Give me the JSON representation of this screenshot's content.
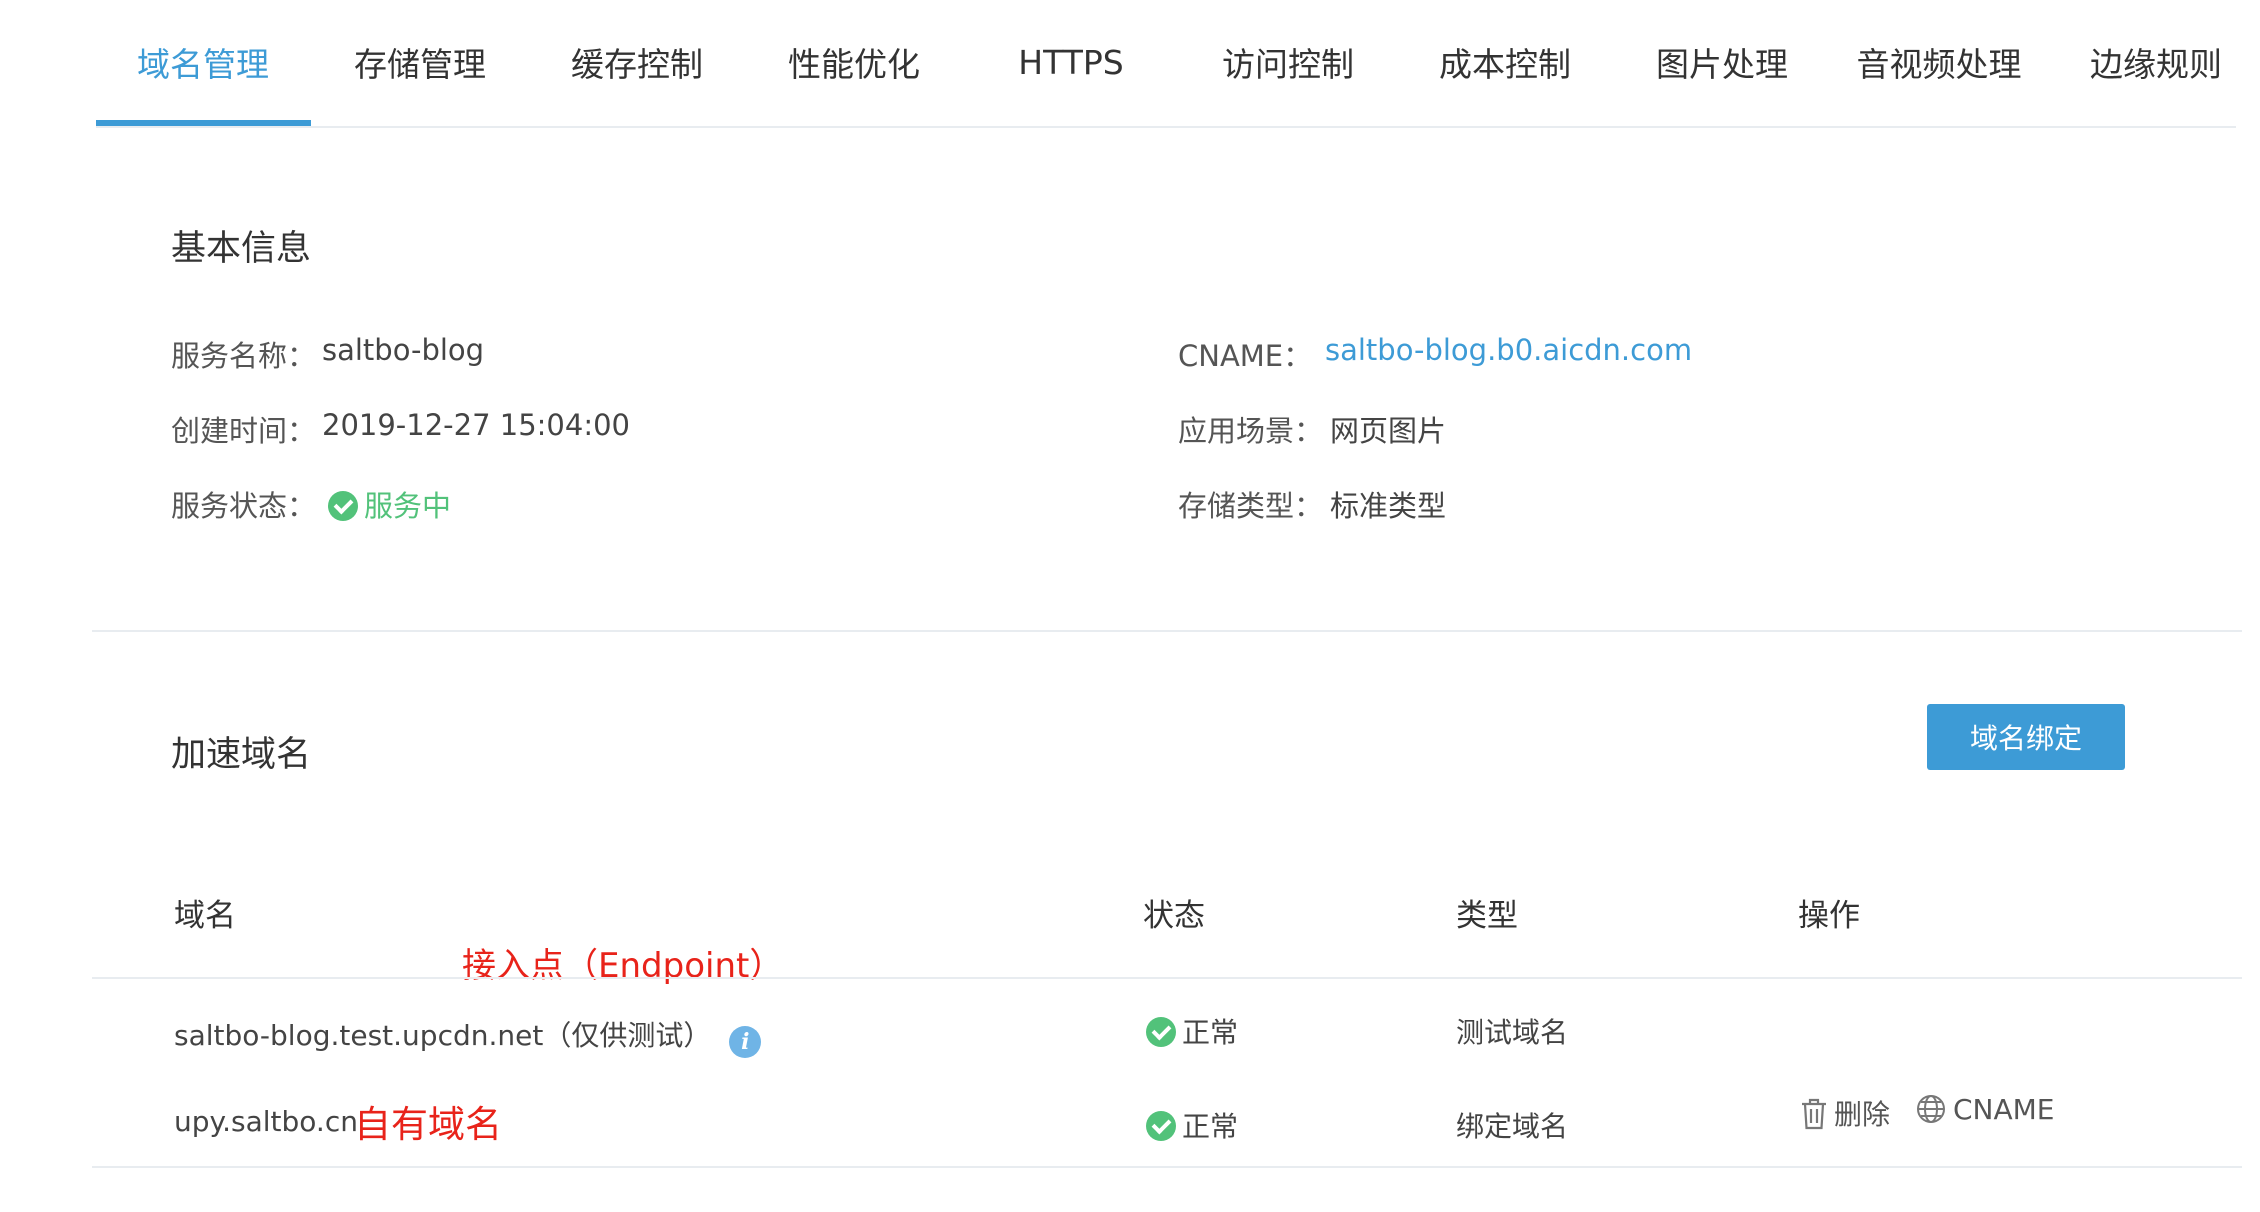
{
  "tabs": [
    {
      "label": "域名管理",
      "active": true
    },
    {
      "label": "存储管理"
    },
    {
      "label": "缓存控制"
    },
    {
      "label": "性能优化"
    },
    {
      "label": "HTTPS"
    },
    {
      "label": "访问控制"
    },
    {
      "label": "成本控制"
    },
    {
      "label": "图片处理"
    },
    {
      "label": "音视频处理"
    },
    {
      "label": "边缘规则"
    }
  ],
  "basic_info": {
    "title": "基本信息",
    "service_name_label": "服务名称：",
    "service_name": "saltbo-blog",
    "created_label": "创建时间：",
    "created": "2019-12-27 15:04:00",
    "status_label": "服务状态：",
    "status": "服务中",
    "cname_label": "CNAME：",
    "cname": "saltbo-blog.b0.aicdn.com",
    "scene_label": "应用场景：",
    "scene": "网页图片",
    "storage_type_label": "存储类型：",
    "storage_type": "标准类型"
  },
  "domains": {
    "title": "加速域名",
    "bind_button": "域名绑定",
    "headers": {
      "domain": "域名",
      "status": "状态",
      "type": "类型",
      "action": "操作"
    },
    "rows": [
      {
        "domain": "saltbo-blog.test.upcdn.net（仅供测试）",
        "status": "正常",
        "type": "测试域名"
      },
      {
        "domain": "upy.saltbo.cn",
        "status": "正常",
        "type": "绑定域名",
        "delete_label": "删除",
        "cname_label": "CNAME"
      }
    ]
  },
  "annotations": {
    "endpoint": "接入点（Endpoint）",
    "own_domain": "自有域名"
  },
  "colors": {
    "accent": "#3d9bd6",
    "success": "#52c27a",
    "annotation": "#e8231a"
  },
  "icons": [
    "check-circle-icon",
    "info-icon",
    "trash-icon",
    "globe-icon"
  ]
}
